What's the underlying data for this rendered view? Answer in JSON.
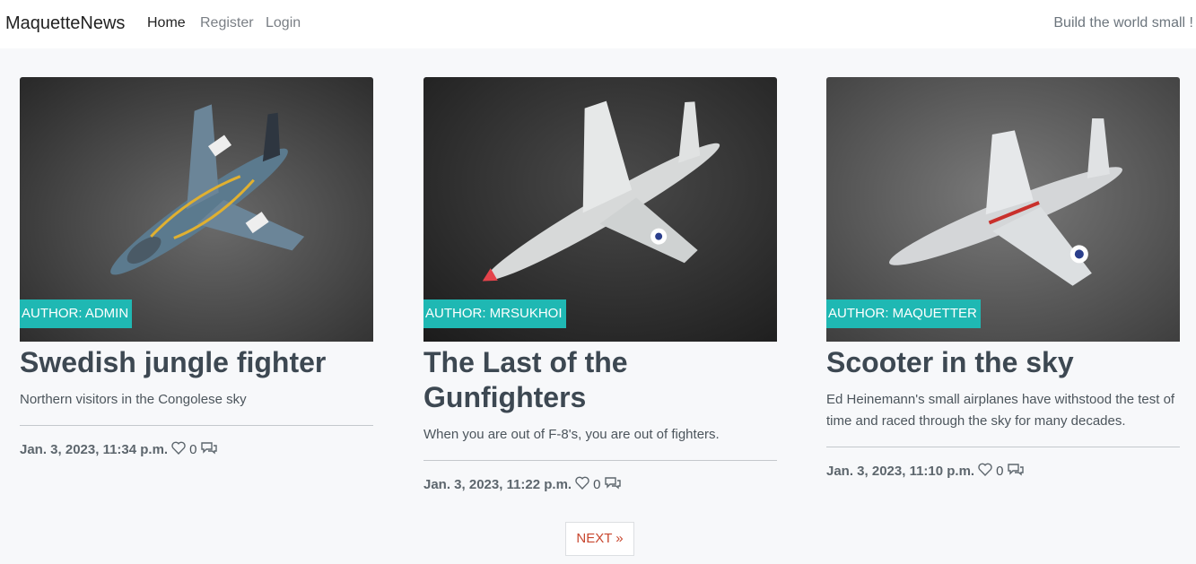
{
  "nav": {
    "brand": "MaquetteNews",
    "links": [
      "Home",
      "Register",
      "Login"
    ],
    "tagline": "Build the world small !"
  },
  "posts": [
    {
      "author": "AUTHOR: ADMIN",
      "title": "Swedish jungle fighter",
      "subtitle": "Northern visitors in the Congolese sky",
      "date": "Jan. 3, 2023, 11:34 p.m.",
      "likes": "0"
    },
    {
      "author": "AUTHOR: MRSUKHOI",
      "title": "The Last of the Gunfighters",
      "subtitle": "When you are out of F-8's, you are out of fighters.",
      "date": "Jan. 3, 2023, 11:22 p.m.",
      "likes": "0"
    },
    {
      "author": "AUTHOR: MAQUETTER",
      "title": "Scooter in the sky",
      "subtitle": "Ed Heinemann's small airplanes have withstood the test of time and raced through the sky for many decades.",
      "date": "Jan. 3, 2023, 11:10 p.m.",
      "likes": "0"
    }
  ],
  "pagination": {
    "next": "NEXT »"
  },
  "colors": {
    "badge": "#1fb8b3",
    "next": "#c8472f"
  }
}
